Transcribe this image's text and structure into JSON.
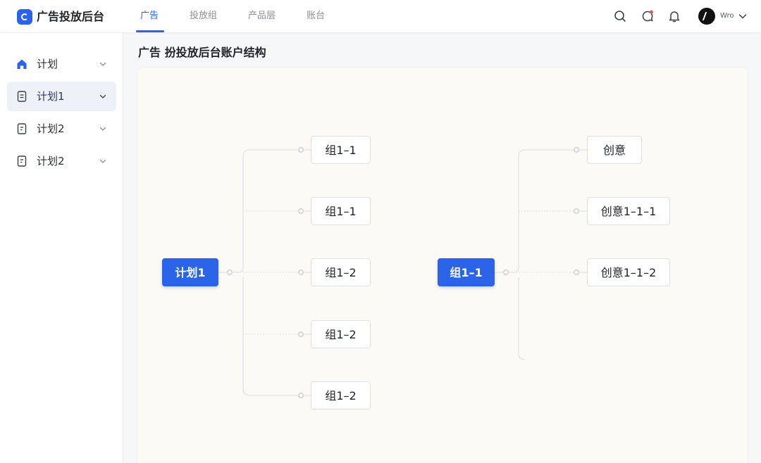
{
  "app": {
    "title": "广告投放后台"
  },
  "nav": {
    "tabs": [
      {
        "label": "广告"
      },
      {
        "label": "投放组"
      },
      {
        "label": "产品层"
      },
      {
        "label": "账台"
      }
    ]
  },
  "header": {
    "user_name": "Wro"
  },
  "sidebar": {
    "items": [
      {
        "label": "计划"
      },
      {
        "label": "计划1"
      },
      {
        "label": "计划2"
      },
      {
        "label": "计划2"
      }
    ]
  },
  "page": {
    "title": "广告 扮投放后台账户结构"
  },
  "tree_left": {
    "root": "计划1",
    "children": [
      "组1–1",
      "组1–1",
      "组1–2",
      "组1–2",
      "组1–2"
    ]
  },
  "tree_right": {
    "root": "组1–1",
    "children": [
      "创意",
      "创意1–1–1",
      "创意1–1–2"
    ]
  },
  "colors": {
    "accent": "#2b63e9",
    "canvas": "#fbfaf4",
    "node_border": "#dcdfe5"
  },
  "icons": {
    "logo": "logo-mark-icon",
    "search": "search-icon",
    "message": "message-icon",
    "bell": "bell-icon",
    "home": "home-icon",
    "doc": "document-icon",
    "chevron": "chevron-down-icon"
  }
}
